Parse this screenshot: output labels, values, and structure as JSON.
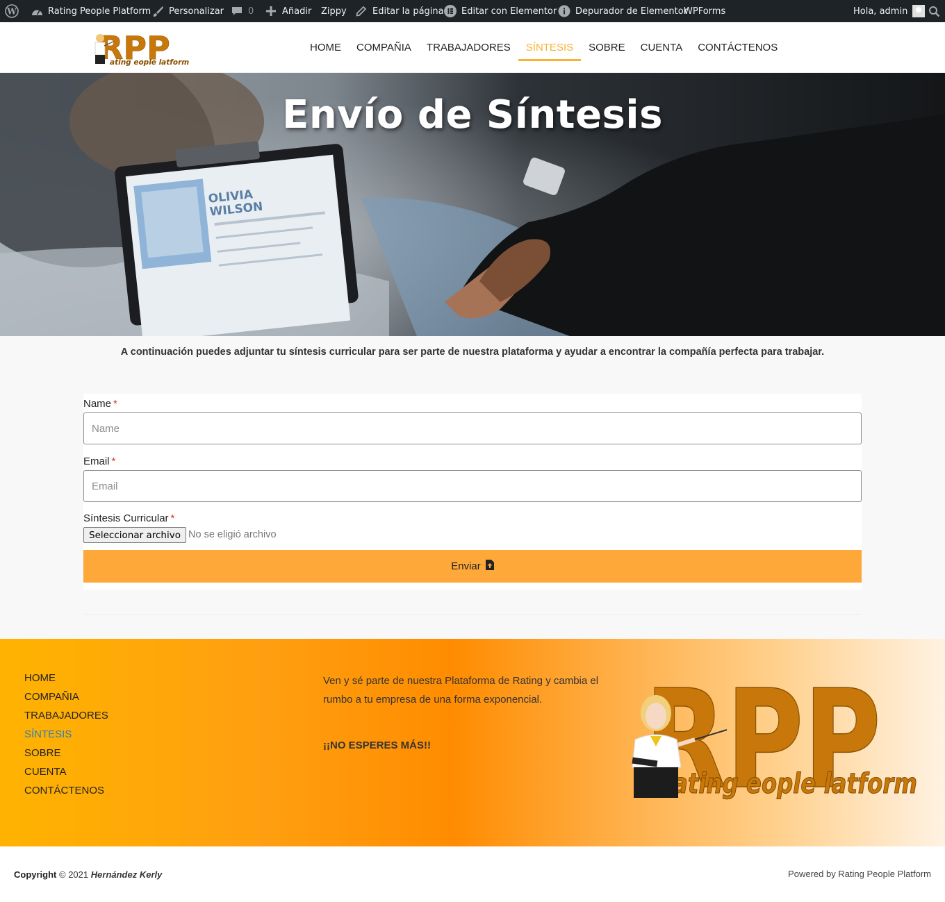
{
  "admin_bar": {
    "site_name": "Rating People Platform",
    "customize": "Personalizar",
    "comments_count": "0",
    "add_new": "Añadir",
    "zippy": "Zippy",
    "edit_page": "Editar la página",
    "edit_elementor": "Editar con Elementor",
    "elementor_debugger": "Depurador de Elementor",
    "wpforms": "WPForms",
    "greeting": "Hola, admin"
  },
  "logo": {
    "letters": "RPP",
    "tagline": "ating eople latform"
  },
  "nav": {
    "items": [
      "HOME",
      "COMPAÑIA",
      "TRABAJADORES",
      "SÍNTESIS",
      "SOBRE",
      "CUENTA",
      "CONTÁCTENOS"
    ],
    "active_index": 3
  },
  "hero": {
    "title": "Envío de Síntesis",
    "photo_name": "OLIVIA\nWILSON"
  },
  "intro": {
    "text": "A continuación puedes adjuntar tu síntesis curricular para ser parte de nuestra plataforma y ayudar a encontrar la compañía perfecta para trabajar."
  },
  "form": {
    "required_mark": "*",
    "name_label": "Name",
    "name_placeholder": "Name",
    "email_label": "Email",
    "email_placeholder": "Email",
    "file_label": "Síntesis Curricular",
    "file_button": "Seleccionar archivo",
    "file_status": "No se eligió archivo",
    "submit_label": "Enviar"
  },
  "footer": {
    "nav_items": [
      "HOME",
      "COMPAÑIA",
      "TRABAJADORES",
      "SÍNTESIS",
      "SOBRE",
      "CUENTA",
      "CONTÁCTENOS"
    ],
    "active_index": 3,
    "text": "Ven y sé parte de nuestra Plataforma de Rating y cambia el rumbo a tu empresa de una forma exponencial.",
    "cta": "¡¡NO ESPERES MÁS!!",
    "logo_letters": "RPP",
    "logo_tagline": "ating eople latform"
  },
  "bottom_bar": {
    "copyright_label": "Copyright",
    "copyright_year": "© 2021",
    "author": "Hernández Kerly",
    "powered": "Powered by Rating People Platform"
  },
  "colors": {
    "accent": "#f9b233",
    "submit_bg": "#fea83a",
    "admin_bar_bg": "#1d2327",
    "logo_orange": "#c8780a",
    "footer_active_link": "#2f7fb4"
  }
}
